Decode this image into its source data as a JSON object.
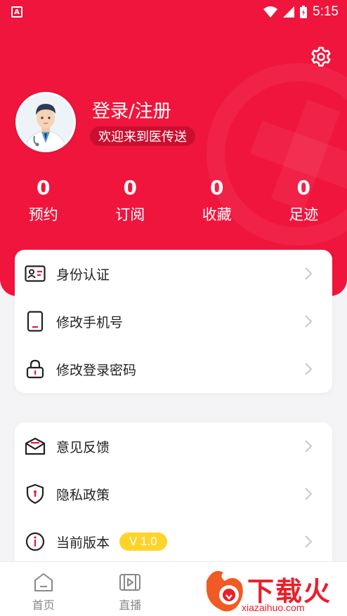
{
  "status_bar": {
    "time": "5:15"
  },
  "profile": {
    "login_title": "登录/注册",
    "welcome": "欢迎来到医传送"
  },
  "stats": [
    {
      "value": "0",
      "label": "预约"
    },
    {
      "value": "0",
      "label": "订阅"
    },
    {
      "value": "0",
      "label": "收藏"
    },
    {
      "value": "0",
      "label": "足迹"
    }
  ],
  "account_menu": [
    {
      "label": "身份认证",
      "icon": "id-card-icon"
    },
    {
      "label": "修改手机号",
      "icon": "phone-icon"
    },
    {
      "label": "修改登录密码",
      "icon": "lock-icon"
    }
  ],
  "info_menu": [
    {
      "label": "意见反馈",
      "icon": "feedback-mail-icon"
    },
    {
      "label": "隐私政策",
      "icon": "shield-icon"
    },
    {
      "label": "当前版本",
      "icon": "info-icon",
      "badge": "V 1.0"
    }
  ],
  "bottom_nav": [
    {
      "label": "首页",
      "icon": "home-icon"
    },
    {
      "label": "直播",
      "icon": "live-video-icon"
    }
  ],
  "watermark": {
    "name": "下载火",
    "site": "xiazaihuo.com"
  },
  "colors": {
    "primary": "#f0153c",
    "badge": "#ffd42a",
    "watermark": "#e8202a"
  }
}
